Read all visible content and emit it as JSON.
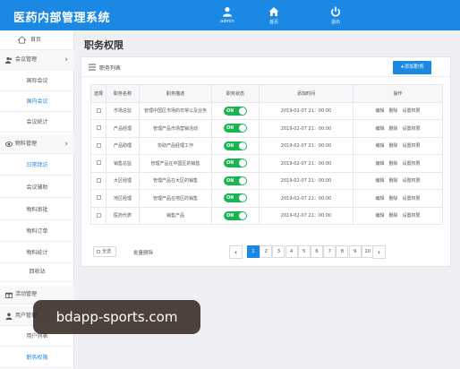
{
  "header": {
    "app_title": "医药内部管理系统",
    "nav": [
      {
        "label": "admin",
        "icon": "user-icon"
      },
      {
        "label": "首页",
        "icon": "home-icon"
      },
      {
        "label": "退出",
        "icon": "power-icon"
      }
    ],
    "color": "#1b88e3"
  },
  "sidebar": {
    "home": "首页",
    "groups": [
      {
        "label": "会议管理",
        "icon": "people-icon"
      },
      {
        "label": "物料管理",
        "icon": "eye-icon"
      },
      {
        "label": "活动管理",
        "icon": "gift-icon"
      },
      {
        "label": "用户管理",
        "icon": "user-icon"
      }
    ],
    "meeting_items": [
      "国际会议",
      "国内会议",
      "会议统计"
    ],
    "material_items": [
      "日常拜访",
      "会议辅助",
      "物料审批",
      "物料订单",
      "物料统计",
      "回收站"
    ],
    "user_items": [
      "用户列表",
      "职务权限"
    ]
  },
  "main": {
    "page_title": "职务权限",
    "card_title": "职务列表",
    "add_button": "添加职务",
    "columns": [
      "选择",
      "职务名称",
      "职务描述",
      "职务状态",
      "添加时间",
      "操作"
    ],
    "rows": [
      {
        "name": "市场总监",
        "desc": "管理中国区市场的日常以及业务",
        "status": "ON",
        "time": "2019-02-07 21：00:00"
      },
      {
        "name": "产品经理",
        "desc": "管理产品市场营销活动",
        "status": "ON",
        "time": "2019-02-07 21：00:00"
      },
      {
        "name": "产品助理",
        "desc": "协助产品经理工作",
        "status": "ON",
        "time": "2019-02-07 21：00:00"
      },
      {
        "name": "销售总监",
        "desc": "管理产品在中国区的销售",
        "status": "ON",
        "time": "2019-02-07 21：00:00"
      },
      {
        "name": "大区经理",
        "desc": "管理产品在大区的销售",
        "status": "ON",
        "time": "2019-02-07 21：00:00"
      },
      {
        "name": "地区经理",
        "desc": "管理产品在地区的销售",
        "status": "ON",
        "time": "2019-02-07 21：00:00"
      },
      {
        "name": "医药代表",
        "desc": "销售产品",
        "status": "ON",
        "time": "2019-02-07 21：00:00"
      }
    ],
    "ops": [
      "编辑",
      "删除",
      "设置权限"
    ],
    "select_all": "全选",
    "batch_delete": "批量删除",
    "pagination": {
      "prev": "‹",
      "next": "›",
      "pages": [
        "1",
        "2",
        "3",
        "4",
        "5",
        "6",
        "7",
        "8",
        "9",
        "10"
      ],
      "current": "1"
    }
  },
  "watermark": "bdapp-sports.com"
}
